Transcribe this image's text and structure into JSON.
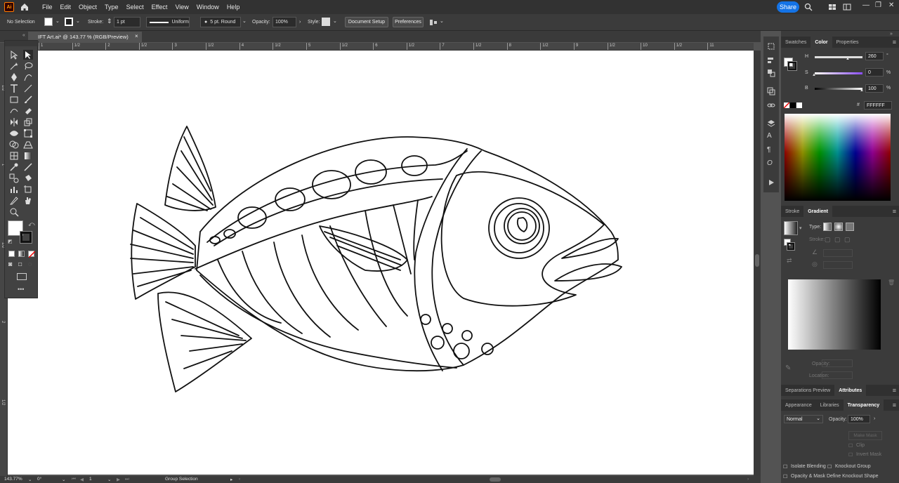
{
  "menubar": {
    "app_logo": "Ai",
    "items": [
      "File",
      "Edit",
      "Object",
      "Type",
      "Select",
      "Effect",
      "View",
      "Window",
      "Help"
    ],
    "share_label": "Share"
  },
  "controlbar": {
    "selection": "No Selection",
    "stroke_label": "Stroke:",
    "stroke_weight": "1 pt",
    "profile": "Uniform",
    "brush": "5 pt. Round",
    "opacity_label": "Opacity:",
    "opacity_value": "100%",
    "style_label": "Style:",
    "document_setup": "Document Setup",
    "preferences": "Preferences"
  },
  "document": {
    "tab_title": "IFT Art.ai* @ 143.77 % (RGB/Preview)"
  },
  "ruler": {
    "h_labels": [
      "1",
      "1/2",
      "2",
      "1/2",
      "3",
      "1/2",
      "4",
      "1/2",
      "5",
      "1/2",
      "6",
      "1/2",
      "7",
      "1/2",
      "8",
      "1/2",
      "9",
      "1/2",
      "10",
      "1/2",
      "11"
    ],
    "v_labels": [
      "1/2",
      "1",
      "1/2",
      "2",
      "1/2"
    ]
  },
  "color_panel": {
    "tabs": [
      "Swatches",
      "Color",
      "Properties"
    ],
    "active_tab": "Color",
    "h_label": "H",
    "h_value": "260",
    "h_unit": "°",
    "s_label": "S",
    "s_value": "0",
    "s_unit": "%",
    "b_label": "B",
    "b_value": "100",
    "b_unit": "%",
    "hex_symbol": "#",
    "hex_value": "FFFFFF"
  },
  "gradient_panel": {
    "tabs": [
      "Stroke",
      "Gradient"
    ],
    "active_tab": "Gradient",
    "type_label": "Type:",
    "stroke_label": "Stroke:",
    "opacity_label": "Opacity:",
    "location_label": "Location:"
  },
  "attributes_panel": {
    "tabs": [
      "Separations Preview",
      "Attributes"
    ],
    "active_tab": "Attributes"
  },
  "transparency_panel": {
    "tabs": [
      "Appearance",
      "Libraries",
      "Transparency"
    ],
    "active_tab": "Transparency",
    "blend_mode": "Normal",
    "opacity_label": "Opacity:",
    "opacity_value": "100%",
    "make_mask": "Make Mask",
    "clip": "Clip",
    "invert_mask": "Invert Mask",
    "isolate_blending": "Isolate Blending",
    "knockout_group": "Knockout Group",
    "opacity_mask_knockout": "Opacity & Mask Define Knockout Shape"
  },
  "statusbar": {
    "zoom": "143.77%",
    "rotation": "0°",
    "artboard": "1",
    "tool_status": "Group Selection"
  },
  "colors": {
    "share_blue": "#1473e6",
    "panel_bg": "#3b3b3b",
    "pasteboard": "#535353"
  }
}
